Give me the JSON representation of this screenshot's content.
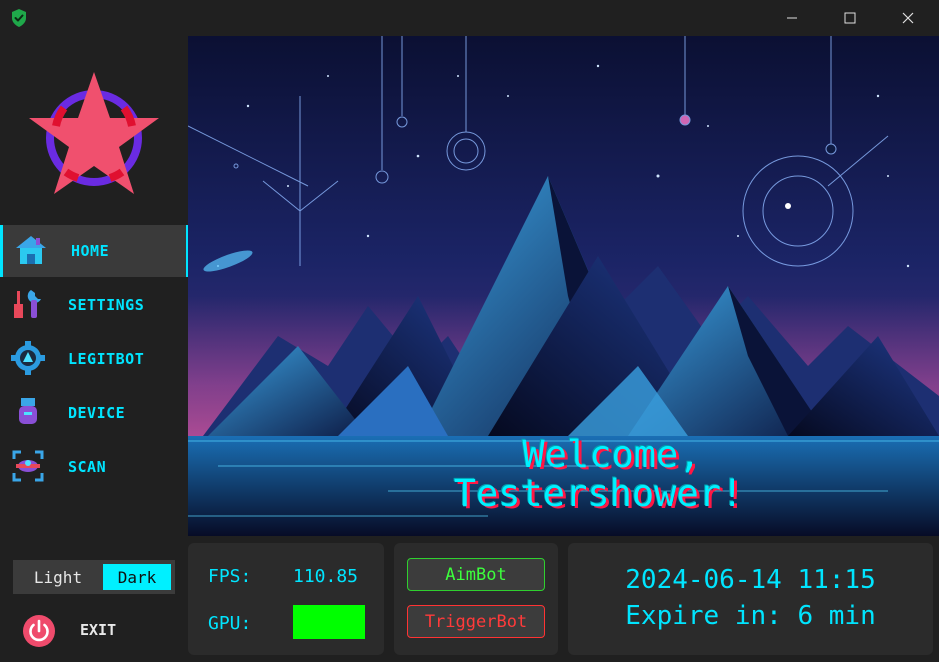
{
  "window": {
    "app_icon": "shield-check-icon",
    "controls": [
      "minimize-icon",
      "maximize-icon",
      "close-icon"
    ]
  },
  "sidebar": {
    "logo": "star-circle-logo",
    "items": [
      {
        "label": "HOME",
        "icon": "home-icon",
        "active": true
      },
      {
        "label": "SETTINGS",
        "icon": "tools-icon",
        "active": false
      },
      {
        "label": "LEGITBOT",
        "icon": "gear-icon",
        "active": false
      },
      {
        "label": "DEVICE",
        "icon": "usb-device-icon",
        "active": false
      },
      {
        "label": "SCAN",
        "icon": "scan-icon",
        "active": false
      }
    ],
    "theme": {
      "light": "Light",
      "dark": "Dark",
      "selected": "Dark"
    },
    "exit": {
      "label": "EXIT",
      "icon": "power-icon"
    }
  },
  "hero": {
    "welcome_line1": "Welcome,",
    "welcome_line2": "Testershower!"
  },
  "stats": {
    "fps_label": "FPS:",
    "fps_value": "110.85",
    "gpu_label": "GPU:",
    "gpu_color": "#00ff00"
  },
  "bots": {
    "aimbot": "AimBot",
    "triggerbot": "TriggerBot",
    "aimbot_color": "#3cff3c",
    "triggerbot_color": "#ff3a3a"
  },
  "session": {
    "datetime": "2024-06-14 11:15",
    "expire": "Expire in: 6 min"
  },
  "colors": {
    "accent": "#00e5ff",
    "background": "#202020",
    "panel": "#2b2b2b"
  }
}
